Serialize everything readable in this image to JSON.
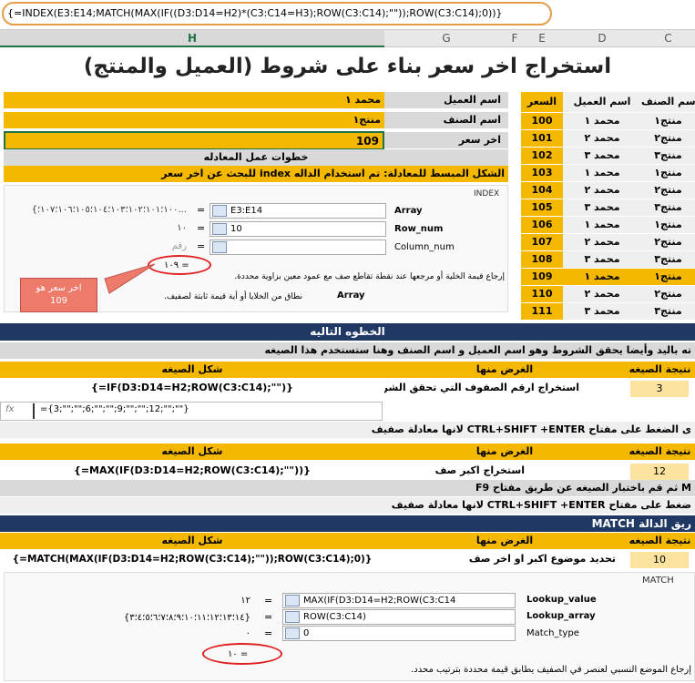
{
  "formula_bar": {
    "formula": "{=INDEX(E3:E14;MATCH(MAX(IF((D3:D14=H2)*(C3:C14=H3);ROW(C3:C14);\"\"));ROW(C3:C14);0))}"
  },
  "columns": [
    "H",
    "G",
    "F",
    "E",
    "D",
    "C"
  ],
  "title": "استخراج اخر سعر بناء على شروط (العميل والمنتج)",
  "table": {
    "headers": {
      "price": "السعر",
      "customer": "اسم العميل",
      "product": "اسم الصنف"
    },
    "rows": [
      {
        "price": "100",
        "customer": "محمد ١",
        "product": "منتج١"
      },
      {
        "price": "101",
        "customer": "محمد ٢",
        "product": "منتج٢"
      },
      {
        "price": "102",
        "customer": "محمد ٣",
        "product": "منتج٣"
      },
      {
        "price": "103",
        "customer": "محمد ١",
        "product": "منتج١"
      },
      {
        "price": "104",
        "customer": "محمد ٢",
        "product": "منتج٢"
      },
      {
        "price": "105",
        "customer": "محمد ٣",
        "product": "منتج٣"
      },
      {
        "price": "106",
        "customer": "محمد ١",
        "product": "منتج١"
      },
      {
        "price": "107",
        "customer": "محمد ٢",
        "product": "منتج٢"
      },
      {
        "price": "108",
        "customer": "محمد ٣",
        "product": "منتج٣"
      },
      {
        "price": "109",
        "customer": "محمد ١",
        "product": "منتج١"
      },
      {
        "price": "110",
        "customer": "محمد ٢",
        "product": "منتج٢"
      },
      {
        "price": "111",
        "customer": "محمد ٣",
        "product": "منتج٣"
      }
    ]
  },
  "criteria": {
    "customer_label": "اسم العميل",
    "customer_value": "محمد ١",
    "product_label": "اسم الصنف",
    "product_value": "منتج١",
    "price_label": "اخر سعر",
    "price_value": "109",
    "steps_title": "خطوات عمل المعادله",
    "simple_form": "الشكل المبسط للمعادلة: تم استخدام الداله index للبحث عن اخر سعر"
  },
  "index_dialog": {
    "func": "INDEX",
    "array_label": "Array",
    "array_value": "E3:E14",
    "array_result": "{١٠٠؛١٠١؛١٠٢؛١٠٣؛١٠٤؛١٠٥؛١٠٦؛١٠٧؛...",
    "row_label": "Row_num",
    "row_value": "10",
    "row_result": "١٠",
    "col_label": "Column_num",
    "col_result": "رقم",
    "result": "١٠٩ =",
    "desc": "إرجاع قيمة الخلية أو مرجعها عند نقطة تقاطع صف مع عمود معين بزاوية محددة.",
    "array_hint_label": "Array",
    "array_hint": "نطاق من الخلايا أو أية قيمة ثابتة لصفيف.",
    "callout": "اخر سعر هو\n109"
  },
  "next_step": {
    "title": "الخطوه التاليه",
    "desc": "ته باليد وأيضا يحقق الشروط وهو اسم العميل و اسم الصنف وهنا ستستخدم هذا الصيغه",
    "h_result": "نتيجة الصيغه",
    "h_purpose": "الغرض منها",
    "h_form": "شكل الصيغه",
    "s1_result": "3",
    "s1_purpose": "استخراج ارقم الصفوف التي تحقق الشروط",
    "s1_form": "{=IF(D3:D14=H2;ROW(C3:C14);\"\")}",
    "array_fx": "fx",
    "array_display": "={3;\"\";\"\";6;\"\";\"\";9;\"\";\"\";12;\"\";\"\"}",
    "ctrl_note1": "ى الضغط على مفتاح CTRL+SHIFT +ENTER لانها معادلة صفيف",
    "s2_result": "12",
    "s2_purpose": "استخراج اكبر صف",
    "s2_form": "{=MAX(IF(D3:D14=H2;ROW(C3:C14);\"\"))}",
    "f9_note": "M ثم قم باختبار الصيغه عن طريق مفتاح F9",
    "ctrl_note2": "ضغط على مفتاح CTRL+SHIFT +ENTER لانها معادلة صفيف",
    "match_title": "ريق الدالة MATCH",
    "s3_result": "10",
    "s3_purpose": "تحديد موضوع اكبر او اخر صف",
    "s3_form": "{=MATCH(MAX(IF(D3:D14=H2;ROW(C3:C14);\"\"));ROW(C3:C14);0)}"
  },
  "match_dialog": {
    "func": "MATCH",
    "lv_label": "Lookup_value",
    "lv_value": "MAX(IF(D3:D14=H2;ROW(C3:C14",
    "lv_result": "١٢",
    "la_label": "Lookup_array",
    "la_value": "ROW(C3:C14)",
    "la_result": "{١٤؛١٣؛١٢؛١١؛١٠؛٩؛٨؛٧؛٦؛٥؛٤؛٣}",
    "mt_label": "Match_type",
    "mt_value": "0",
    "mt_result": "٠",
    "result": "١٠ =",
    "desc": "إرجاع الموضع النسبي لعنصر في الصفيف يطابق قيمة محددة بترتيب محدد."
  }
}
